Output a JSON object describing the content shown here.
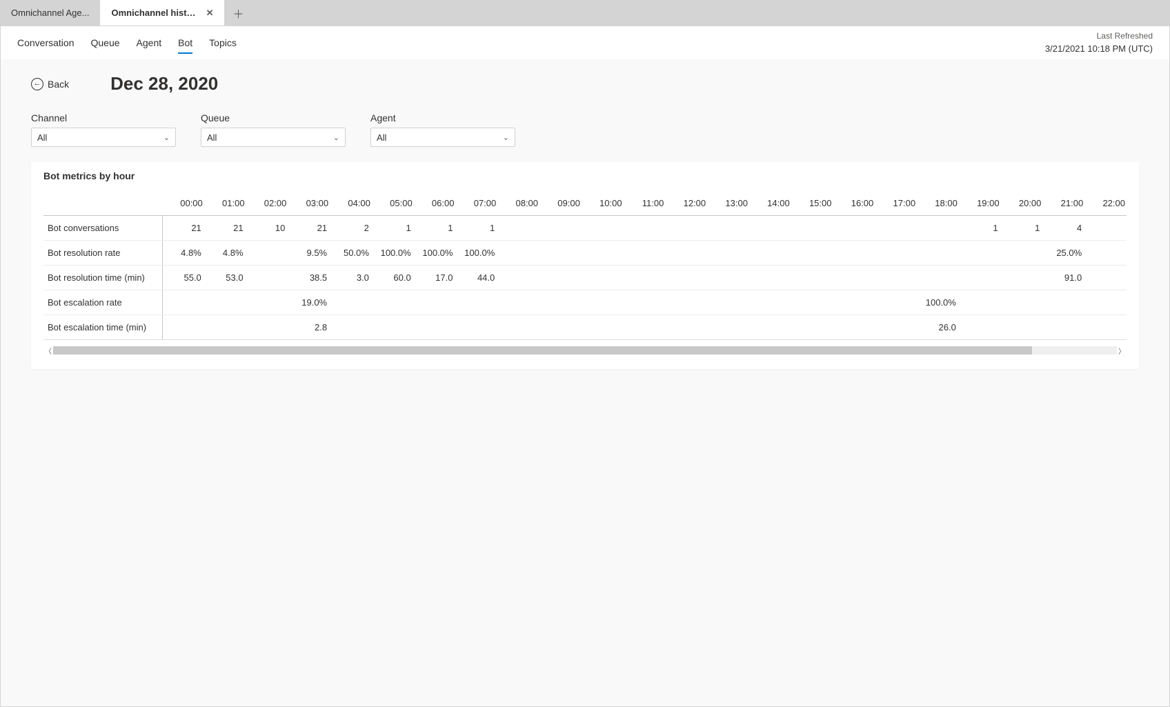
{
  "tabs": {
    "inactive_label": "Omnichannel Age...",
    "active_label": "Omnichannel historical an..."
  },
  "nav": {
    "items": [
      "Conversation",
      "Queue",
      "Agent",
      "Bot",
      "Topics"
    ],
    "active_index": 3
  },
  "refresh": {
    "label": "Last Refreshed",
    "timestamp": "3/21/2021 10:18 PM (UTC)"
  },
  "back_label": "Back",
  "page_title": "Dec 28, 2020",
  "filters": [
    {
      "label": "Channel",
      "value": "All"
    },
    {
      "label": "Queue",
      "value": "All"
    },
    {
      "label": "Agent",
      "value": "All"
    }
  ],
  "card_title": "Bot metrics by hour",
  "chart_data": {
    "type": "table",
    "columns": [
      "00:00",
      "01:00",
      "02:00",
      "03:00",
      "04:00",
      "05:00",
      "06:00",
      "07:00",
      "08:00",
      "09:00",
      "10:00",
      "11:00",
      "12:00",
      "13:00",
      "14:00",
      "15:00",
      "16:00",
      "17:00",
      "18:00",
      "19:00",
      "20:00",
      "21:00",
      "22:00"
    ],
    "rows": [
      {
        "name": "Bot conversations",
        "values": [
          "21",
          "21",
          "10",
          "21",
          "2",
          "1",
          "1",
          "1",
          "",
          "",
          "",
          "",
          "",
          "",
          "",
          "",
          "",
          "",
          "",
          "1",
          "1",
          "4",
          ""
        ]
      },
      {
        "name": "Bot resolution rate",
        "values": [
          "4.8%",
          "4.8%",
          "",
          "9.5%",
          "50.0%",
          "100.0%",
          "100.0%",
          "100.0%",
          "",
          "",
          "",
          "",
          "",
          "",
          "",
          "",
          "",
          "",
          "",
          "",
          "",
          "25.0%",
          ""
        ]
      },
      {
        "name": "Bot resolution time (min)",
        "values": [
          "55.0",
          "53.0",
          "",
          "38.5",
          "3.0",
          "60.0",
          "17.0",
          "44.0",
          "",
          "",
          "",
          "",
          "",
          "",
          "",
          "",
          "",
          "",
          "",
          "",
          "",
          "91.0",
          ""
        ]
      },
      {
        "name": "Bot escalation rate",
        "values": [
          "",
          "",
          "",
          "19.0%",
          "",
          "",
          "",
          "",
          "",
          "",
          "",
          "",
          "",
          "",
          "",
          "",
          "",
          "",
          "100.0%",
          "",
          "",
          "",
          ""
        ]
      },
      {
        "name": "Bot escalation time (min)",
        "values": [
          "",
          "",
          "",
          "2.8",
          "",
          "",
          "",
          "",
          "",
          "",
          "",
          "",
          "",
          "",
          "",
          "",
          "",
          "",
          "26.0",
          "",
          "",
          "",
          ""
        ]
      }
    ]
  }
}
